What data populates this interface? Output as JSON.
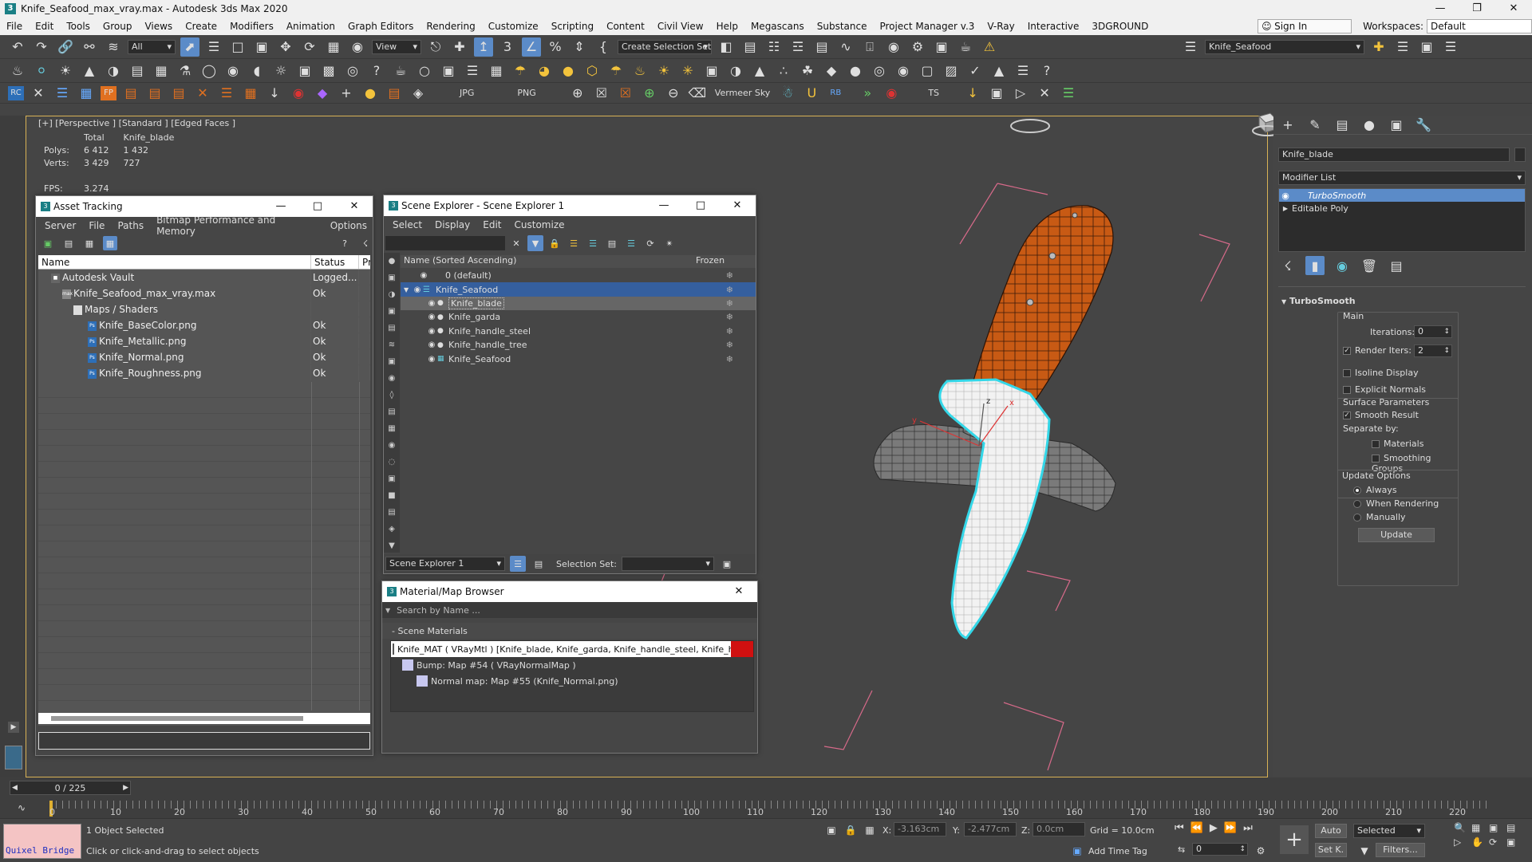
{
  "window": {
    "title": "Knife_Seafood_max_vray.max - Autodesk 3ds Max 2020"
  },
  "menu": [
    "File",
    "Edit",
    "Tools",
    "Group",
    "Views",
    "Create",
    "Modifiers",
    "Animation",
    "Graph Editors",
    "Rendering",
    "Customize",
    "Scripting",
    "Content",
    "Civil View",
    "Help",
    "Megascans",
    "Substance",
    "Project Manager v.3",
    "V-Ray",
    "Interactive",
    "3DGROUND"
  ],
  "account": {
    "signin": "Sign In",
    "workspaces_label": "Workspaces:",
    "workspace": "Default"
  },
  "toolbar": {
    "filter": "All",
    "view": "View",
    "selection_set": "Create Selection Set",
    "object_name": "Knife_Seafood",
    "jpg": "JPG",
    "png": "PNG",
    "sky": "Vermeer Sky",
    "ts": "TS",
    "rc": "RC",
    "fp": "FP"
  },
  "viewport": {
    "label": "[+] [Perspective ] [Standard ] [Edged Faces ]",
    "stats": {
      "col_total": "Total",
      "col_obj": "Knife_blade",
      "polys_label": "Polys:",
      "polys_total": "6 412",
      "polys_obj": "1 432",
      "verts_label": "Verts:",
      "verts_total": "3 429",
      "verts_obj": "727",
      "fps_label": "FPS:",
      "fps": "3.274"
    }
  },
  "asset_tracking": {
    "title": "Asset Tracking",
    "menu": [
      "Server",
      "File",
      "Paths",
      "Bitmap Performance and Memory",
      "Options"
    ],
    "columns": [
      "Name",
      "Status",
      "Pro"
    ],
    "rows": [
      {
        "name": "Autodesk Vault",
        "status": "Logged..."
      },
      {
        "name": "Knife_Seafood_max_vray.max",
        "status": "Ok"
      },
      {
        "name": "Maps / Shaders",
        "status": ""
      },
      {
        "name": "Knife_BaseColor.png",
        "status": "Ok"
      },
      {
        "name": "Knife_Metallic.png",
        "status": "Ok"
      },
      {
        "name": "Knife_Normal.png",
        "status": "Ok"
      },
      {
        "name": "Knife_Roughness.png",
        "status": "Ok"
      }
    ]
  },
  "scene_explorer": {
    "title": "Scene Explorer - Scene Explorer 1",
    "menu": [
      "Select",
      "Display",
      "Edit",
      "Customize"
    ],
    "col_name": "Name (Sorted Ascending)",
    "col_frozen": "Frozen",
    "rows": [
      {
        "name": "0 (default)"
      },
      {
        "name": "Knife_Seafood"
      },
      {
        "name": "Knife_blade"
      },
      {
        "name": "Knife_garda"
      },
      {
        "name": "Knife_handle_steel"
      },
      {
        "name": "Knife_handle_tree"
      },
      {
        "name": "Knife_Seafood"
      }
    ],
    "footer_explorer": "Scene Explorer 1",
    "footer_selset": "Selection Set:"
  },
  "material_browser": {
    "title": "Material/Map Browser",
    "search": "Search by Name ...",
    "section": "- Scene Materials",
    "items": [
      "Knife_MAT  ( VRayMtl )  [Knife_blade, Knife_garda, Knife_handle_steel, Knife_handle_...",
      "Bump: Map #54  ( VRayNormalMap )",
      "Normal map: Map #55 (Knife_Normal.png)"
    ]
  },
  "command_panel": {
    "object_name": "Knife_blade",
    "modifier_list": "Modifier List",
    "stack": [
      "TurboSmooth",
      "Editable Poly"
    ],
    "rollout": "TurboSmooth",
    "main": "Main",
    "iterations_label": "Iterations:",
    "iterations": "0",
    "render_iters_label": "Render Iters:",
    "render_iters": "2",
    "isoline": "Isoline Display",
    "explicit": "Explicit Normals",
    "surface_params": "Surface Parameters",
    "smooth_result": "Smooth Result",
    "separate_by": "Separate by:",
    "materials": "Materials",
    "smoothing_groups": "Smoothing Groups",
    "update_options": "Update Options",
    "always": "Always",
    "when_rendering": "When Rendering",
    "manually": "Manually",
    "update_btn": "Update"
  },
  "timeline": {
    "frame": "0 / 225",
    "ticks": [
      "0",
      "10",
      "20",
      "30",
      "40",
      "50",
      "60",
      "70",
      "80",
      "90",
      "100",
      "110",
      "120",
      "130",
      "140",
      "150",
      "160",
      "170",
      "180",
      "190",
      "200",
      "210",
      "220"
    ]
  },
  "status": {
    "quixel": "Quixel Bridge",
    "selected": "1 Object Selected",
    "hint": "Click or click-and-drag to select objects",
    "x_label": "X:",
    "x": "-3.163cm",
    "y_label": "Y:",
    "y": "-2.477cm",
    "z_label": "Z:",
    "z": "0.0cm",
    "grid": "Grid = 10.0cm",
    "add_time_tag": "Add Time Tag",
    "auto": "Auto",
    "setk": "Set K.",
    "selected_mode": "Selected",
    "filters": "Filters...",
    "frame_field": "0"
  }
}
